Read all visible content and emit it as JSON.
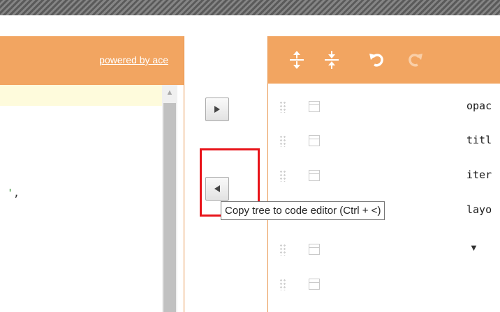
{
  "left_panel": {
    "powered_by": "powered by ace",
    "code_fragment": {
      "quote": "'",
      "comma": ","
    }
  },
  "buttons": {
    "copy_to_tree_icon": "play-right",
    "copy_to_code_icon": "play-left"
  },
  "tooltip": {
    "text": "Copy tree to code editor (Ctrl + <)"
  },
  "right_panel": {
    "toolbar_icons": [
      "expand-all-icon",
      "collapse-all-icon",
      "undo-icon",
      "redo-icon"
    ],
    "rows": [
      {
        "field": "opac"
      },
      {
        "field": "titl"
      },
      {
        "field": "iter"
      },
      {
        "field": "layo"
      },
      {
        "field": "",
        "toggle": "▼"
      },
      {
        "field": ""
      }
    ]
  },
  "colors": {
    "panel_orange": "#f2a561",
    "highlight_red": "#e8141a",
    "active_line": "#fefbdc"
  }
}
